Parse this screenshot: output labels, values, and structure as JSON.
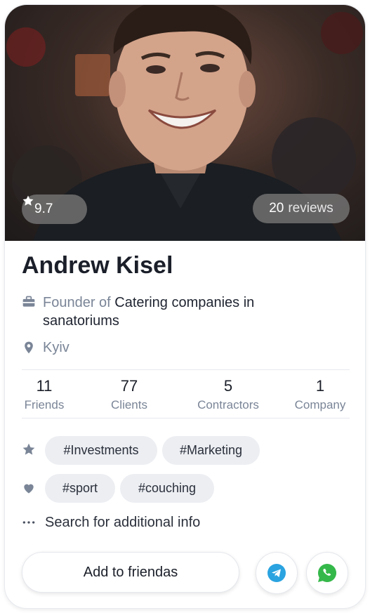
{
  "profile": {
    "rating": "9.7",
    "reviews_count": "20",
    "reviews_label": "reviews",
    "name": "Andrew Kisel",
    "job_prefix": "Founder of",
    "job_company": "Catering companies in sanatoriums",
    "city": "Kyiv"
  },
  "stats": [
    {
      "value": "11",
      "label": "Friends"
    },
    {
      "value": "77",
      "label": "Clients"
    },
    {
      "value": "5",
      "label": "Contractors"
    },
    {
      "value": "1",
      "label": "Company"
    }
  ],
  "interests": [
    "#Investments",
    "#Marketing"
  ],
  "hobbies": [
    "#sport",
    "#couching"
  ],
  "more_info_label": "Search for additional info",
  "actions": {
    "add_friend_label": "Add to friendas",
    "telegram_icon": "telegram-icon",
    "whatsapp_icon": "whatsapp-icon"
  },
  "colors": {
    "telegram": "#2aa3e0",
    "whatsapp": "#35b84a",
    "muted_text": "#7a8597",
    "tag_bg": "#eceef2"
  }
}
